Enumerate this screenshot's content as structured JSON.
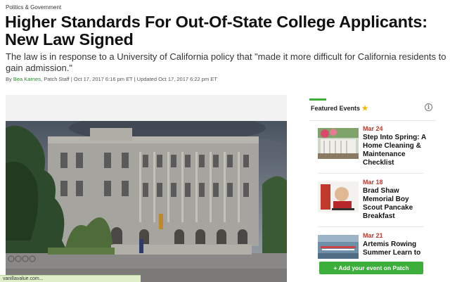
{
  "article": {
    "category": "Politics & Government",
    "headline": "Higher Standards For Out-Of-State College Applicants: New Law Signed",
    "subhead": "The law is in response to a University of California policy that \"made it more difficult for California residents to gain admission.\"",
    "byline_prefix": "By ",
    "author": "Bea Karnes",
    "byline_rest": ", Patch Staff | Oct 17, 2017 6:16 pm ET | Updated Oct 17, 2017 6:22 pm ET"
  },
  "sidebar": {
    "title": "Featured Events",
    "star_icon": "star-icon",
    "info_icon": "info-icon",
    "info_glyph": "i",
    "events": [
      {
        "date": "Mar 24",
        "title": "Step Into Spring: A Home Cleaning & Maintenance Checklist"
      },
      {
        "date": "Mar 18",
        "title": "Brad Shaw Memorial Boy Scout Pancake Breakfast"
      },
      {
        "date": "Mar 21",
        "title": "Artemis Rowing Summer Learn to"
      }
    ],
    "add_event_label": "+ Add your event on Patch"
  },
  "status_bar": {
    "url": "vanillavalue.com..."
  },
  "colors": {
    "accent": "#3cae3c",
    "date": "#c0392b",
    "author": "#2a8a2a"
  }
}
